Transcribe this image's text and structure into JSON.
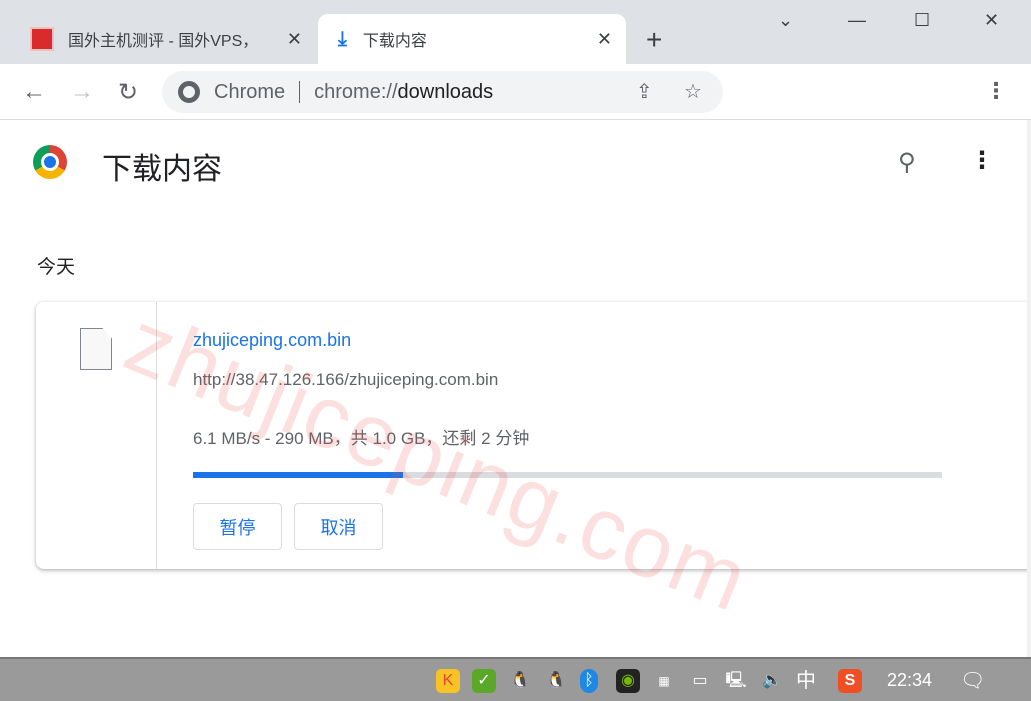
{
  "tabs": [
    {
      "title": "国外主机测评 - 国外VPS，",
      "icon": "site-favicon"
    },
    {
      "title": "下载内容",
      "icon": "download-icon"
    }
  ],
  "window": {
    "new_tab": "+",
    "minimize": "—",
    "maximize": "☐",
    "close": "✕",
    "tab_list": "⌄"
  },
  "omnibox": {
    "chip": "Chrome",
    "url_scheme": "chrome://",
    "url_host": "downloads"
  },
  "page": {
    "title": "下载内容",
    "date_header": "今天"
  },
  "download": {
    "filename": "zhujiceping.com.bin",
    "url": "http://38.47.126.166/zhujiceping.com.bin",
    "status": "6.1 MB/s - 290 MB，共 1.0 GB，还剩 2 分钟",
    "progress_percent": 28,
    "pause": "暂停",
    "cancel": "取消"
  },
  "watermark": "zhujiceping.com",
  "taskbar": {
    "ime": "中",
    "clock": "22:34"
  },
  "colors": {
    "accent": "#1a73e8",
    "tabstrip": "#dee1e6",
    "taskbar": "#9a9a9a"
  }
}
